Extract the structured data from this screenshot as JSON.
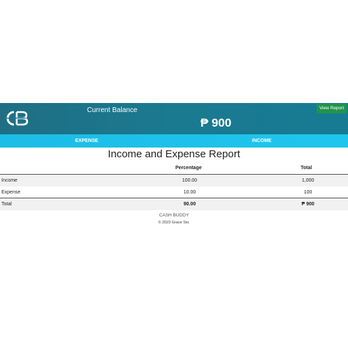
{
  "header": {
    "logo_icon": "cb-logo-icon",
    "logo_text": "CB",
    "balance_label": "Current Balance",
    "balance_amount": "₱ 900",
    "view_report_label": "View Report"
  },
  "tabs": [
    {
      "label": "EXPENSE"
    },
    {
      "label": "INCOME"
    }
  ],
  "report": {
    "title": "Income and Expense Report",
    "columns": [
      "",
      "Percentage",
      "Total"
    ],
    "rows": [
      {
        "label": "Income",
        "percentage": "100.00",
        "total": "1,000"
      },
      {
        "label": "Expense",
        "percentage": "10.00",
        "total": "100"
      }
    ],
    "total_row": {
      "label": "Total",
      "percentage": "90.00",
      "total": "₱ 900"
    }
  },
  "footer": {
    "brand": "CASH BUDDY",
    "copyright": "© 2023 Grace Sio."
  },
  "colors": {
    "header_bg": "#1a7a90",
    "tabbar_bg": "#1ec6ee",
    "view_button_bg": "#21944d",
    "text": "#222222"
  }
}
